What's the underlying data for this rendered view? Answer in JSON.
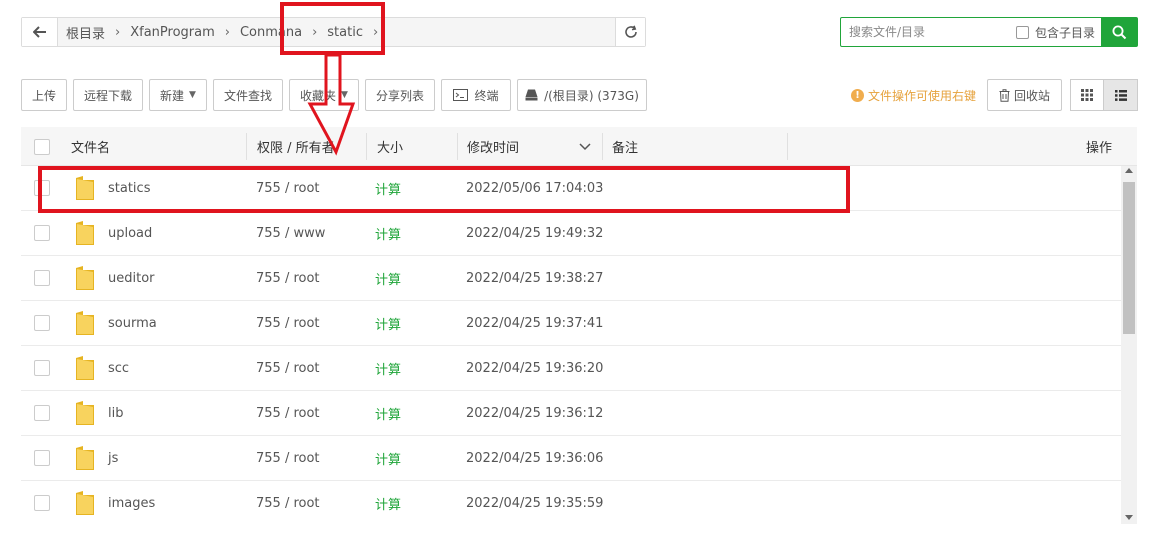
{
  "path": {
    "crumbs": [
      "根目录",
      "XfanProgram",
      "Conmana",
      "static"
    ]
  },
  "search": {
    "placeholder": "搜索文件/目录",
    "include_subdirs_label": "包含子目录"
  },
  "toolbar": {
    "upload": "上传",
    "remote_download": "远程下载",
    "new": "新建",
    "file_search": "文件查找",
    "favorites": "收藏夹",
    "share_list": "分享列表",
    "terminal": "终端",
    "disk": "/(根目录) (373G)"
  },
  "hint": "文件操作可使用右键",
  "recycle": "回收站",
  "table": {
    "headers": {
      "name": "文件名",
      "perm": "权限 / 所有者",
      "size": "大小",
      "mtime": "修改时间",
      "note": "备注",
      "actions": "操作"
    },
    "rows": [
      {
        "name": "statics",
        "perm": "755 / root",
        "size": "计算",
        "mtime": "2022/05/06 17:04:03"
      },
      {
        "name": "upload",
        "perm": "755 / www",
        "size": "计算",
        "mtime": "2022/04/25 19:49:32"
      },
      {
        "name": "ueditor",
        "perm": "755 / root",
        "size": "计算",
        "mtime": "2022/04/25 19:38:27"
      },
      {
        "name": "sourma",
        "perm": "755 / root",
        "size": "计算",
        "mtime": "2022/04/25 19:37:41"
      },
      {
        "name": "scc",
        "perm": "755 / root",
        "size": "计算",
        "mtime": "2022/04/25 19:36:20"
      },
      {
        "name": "lib",
        "perm": "755 / root",
        "size": "计算",
        "mtime": "2022/04/25 19:36:12"
      },
      {
        "name": "js",
        "perm": "755 / root",
        "size": "计算",
        "mtime": "2022/04/25 19:36:06"
      },
      {
        "name": "images",
        "perm": "755 / root",
        "size": "计算",
        "mtime": "2022/04/25 19:35:59"
      }
    ]
  },
  "colors": {
    "accent_green": "#20a53a",
    "annotation_red": "#e0141e",
    "folder_yellow": "#f5c842",
    "hint_orange": "#e6a23c"
  }
}
